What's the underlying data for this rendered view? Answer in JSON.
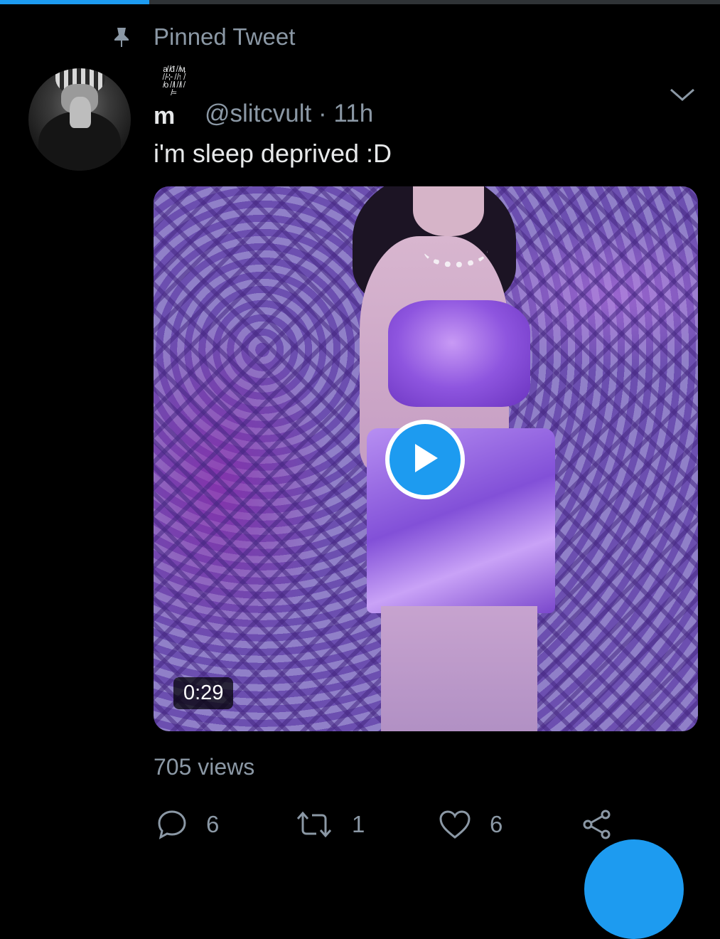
{
  "top_progress": {
    "fraction": 0.207
  },
  "pinned": {
    "label": "Pinned Tweet",
    "icon": "pin-icon"
  },
  "tweet": {
    "display_name": "m",
    "display_name_decoration": "a̸ ̸đ ̸ ̸ӎ ̸ ̸⊹ ̸ ̸↑ ̸ ̸о ̸ ̸ӏ ̸ ̸ӏ ̸ ̸≈",
    "handle_time": "@slitcvult · 11h",
    "text": "i'm sleep deprived :D",
    "video": {
      "duration": "0:29",
      "play_icon": "play-icon"
    },
    "views": "705 views",
    "actions": {
      "reply_count": "6",
      "retweet_count": "1",
      "like_count": "6"
    }
  },
  "colors": {
    "background": "#000000",
    "text_primary": "#e7e9ea",
    "text_secondary": "#8b98a5",
    "accent": "#1d9bf0"
  }
}
